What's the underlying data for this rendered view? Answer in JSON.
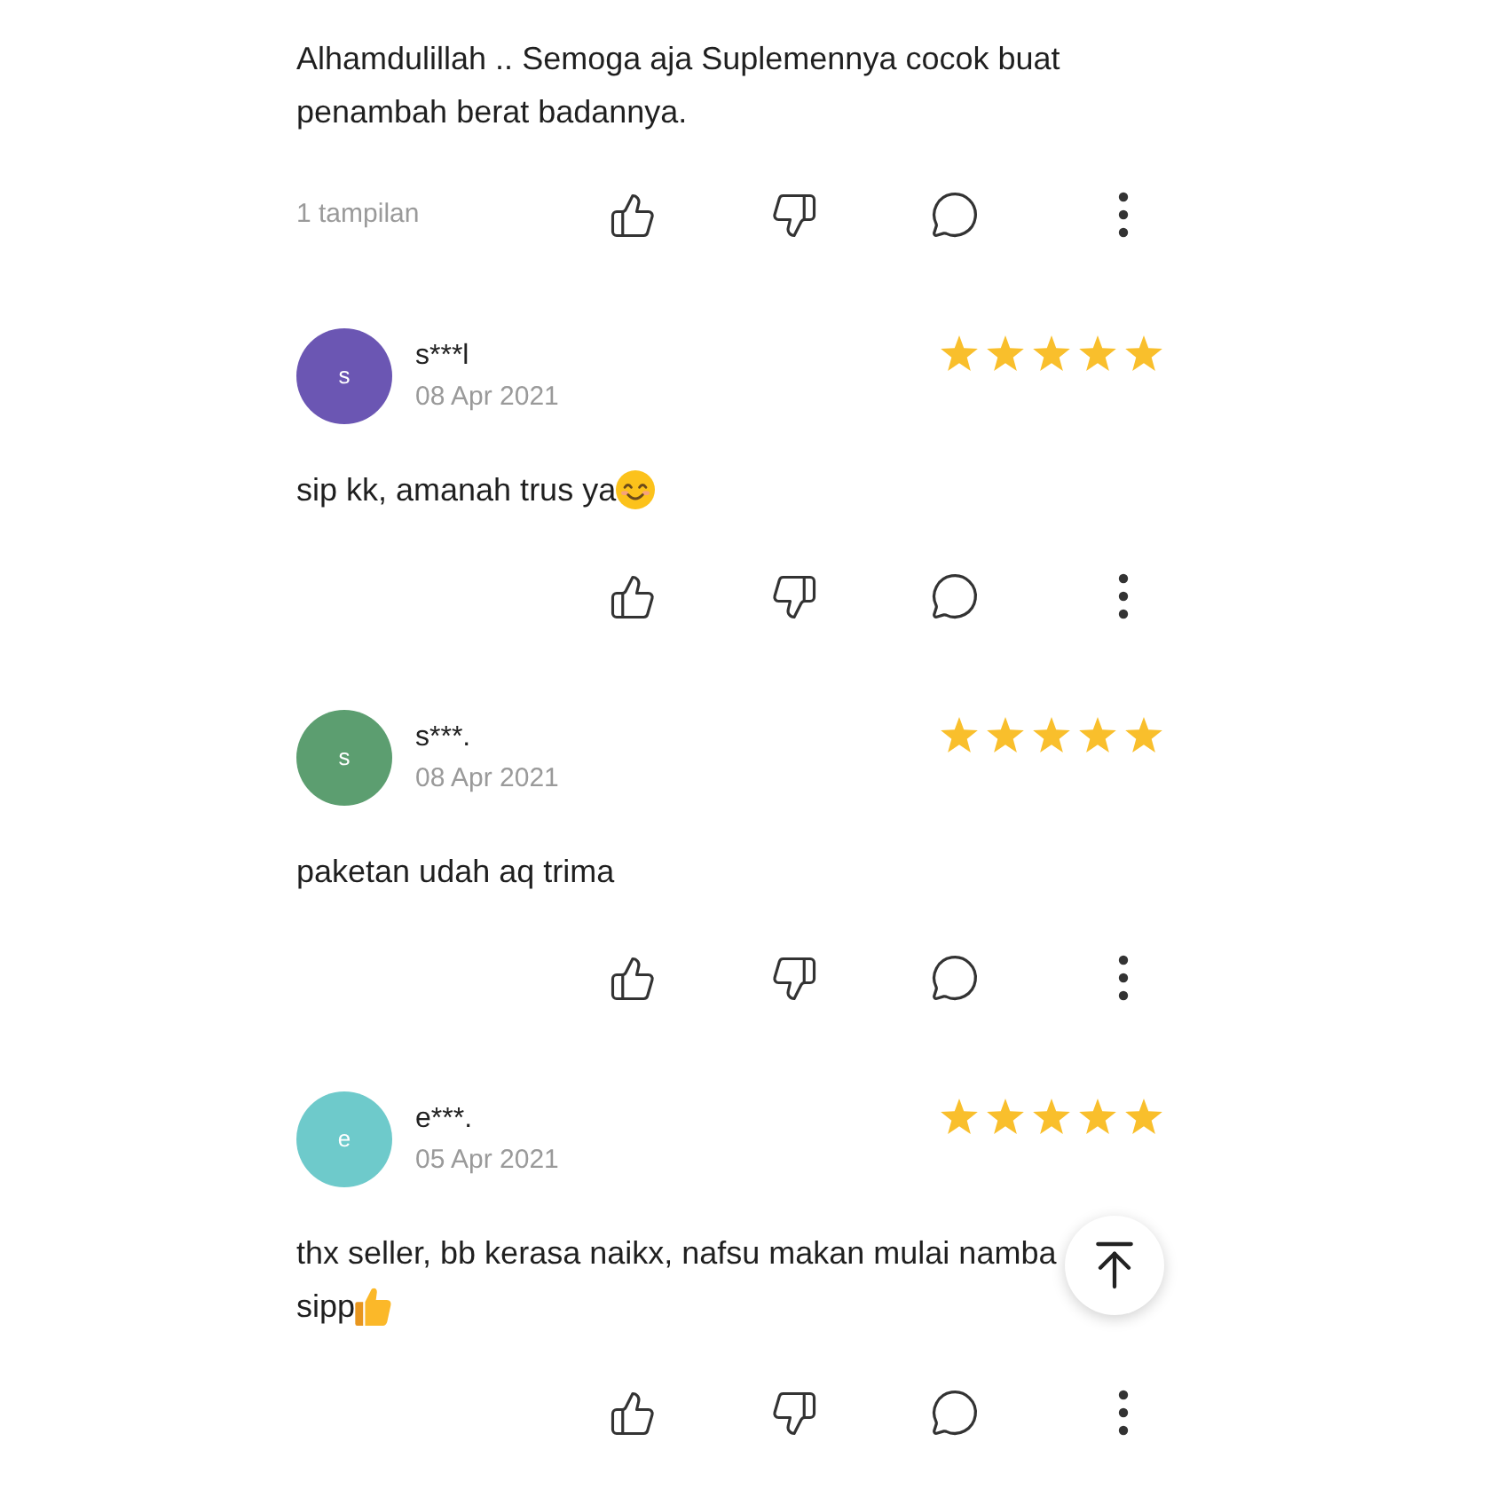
{
  "reviews": [
    {
      "text_lines": [
        "Alhamdulillah .. Semoga aja Suplemennya cocok buat penambah berat badannya."
      ],
      "views": "1 tampilan"
    },
    {
      "avatar": {
        "letter": "s",
        "color": "#6b56b3"
      },
      "name": "s***l",
      "date": "08 Apr 2021",
      "stars": 5,
      "text_lines": [
        "sip kk, amanah trus ya"
      ],
      "emoji": {
        "kind": "smiling_face"
      }
    },
    {
      "avatar": {
        "letter": "s",
        "color": "#5c9e70"
      },
      "name": "s***.",
      "date": "08 Apr 2021",
      "stars": 5,
      "text_lines": [
        "paketan udah aq trima"
      ]
    },
    {
      "avatar": {
        "letter": "e",
        "color": "#6ecacb"
      },
      "name": "e***.",
      "date": "05 Apr 2021",
      "stars": 5,
      "text_lines": [
        "thx seller, bb kerasa naikx, nafsu makan mulai namba",
        "sipp"
      ],
      "emoji": {
        "kind": "thumbs_up"
      }
    }
  ]
}
